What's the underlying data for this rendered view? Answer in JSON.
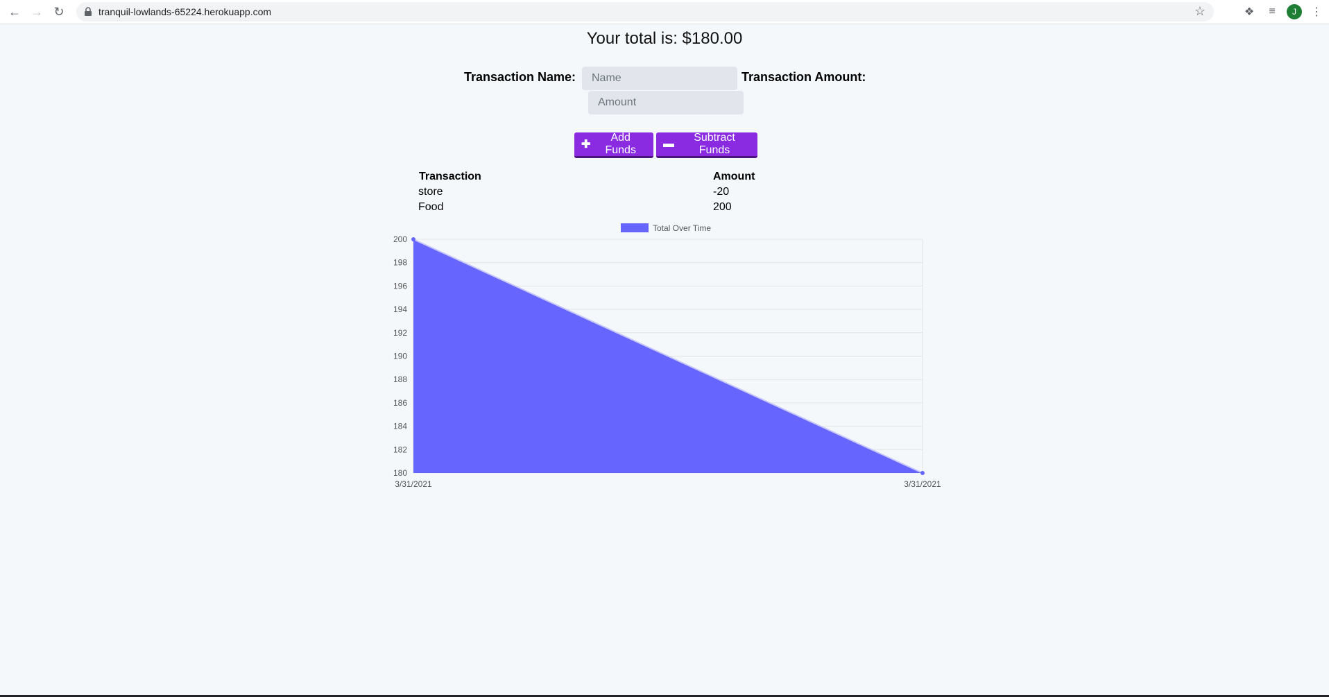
{
  "browser": {
    "url": "tranquil-lowlands-65224.herokuapp.com",
    "avatar_letter": "J",
    "icons": [
      "back-icon",
      "forward-icon",
      "reload-icon",
      "lock-icon",
      "star-icon",
      "extensions-icon",
      "reading-list-icon",
      "menu-icon"
    ]
  },
  "page": {
    "total_text": "Your total is: $180.00",
    "form": {
      "name_label": "Transaction Name:",
      "name_placeholder": "Name",
      "amount_label": "Transaction Amount:",
      "amount_placeholder": "Amount"
    },
    "buttons": {
      "add_label": "Add Funds",
      "subtract_label": "Subtract Funds"
    },
    "table": {
      "headers": [
        "Transaction",
        "Amount"
      ],
      "rows": [
        [
          "store",
          "-20"
        ],
        [
          "Food",
          "200"
        ]
      ]
    }
  },
  "colors": {
    "accent": "#8a2be2",
    "chart_fill": "#6666ff",
    "background": "#f5f8fb"
  },
  "chart_data": {
    "type": "area",
    "categories": [
      "3/31/2021",
      "3/31/2021"
    ],
    "series": [
      {
        "name": "Total Over Time",
        "values": [
          200,
          180
        ]
      }
    ],
    "ylim": [
      180,
      200
    ],
    "yticks": [
      180,
      182,
      184,
      186,
      188,
      190,
      192,
      194,
      196,
      198,
      200
    ],
    "grid": true,
    "legend": "top"
  }
}
